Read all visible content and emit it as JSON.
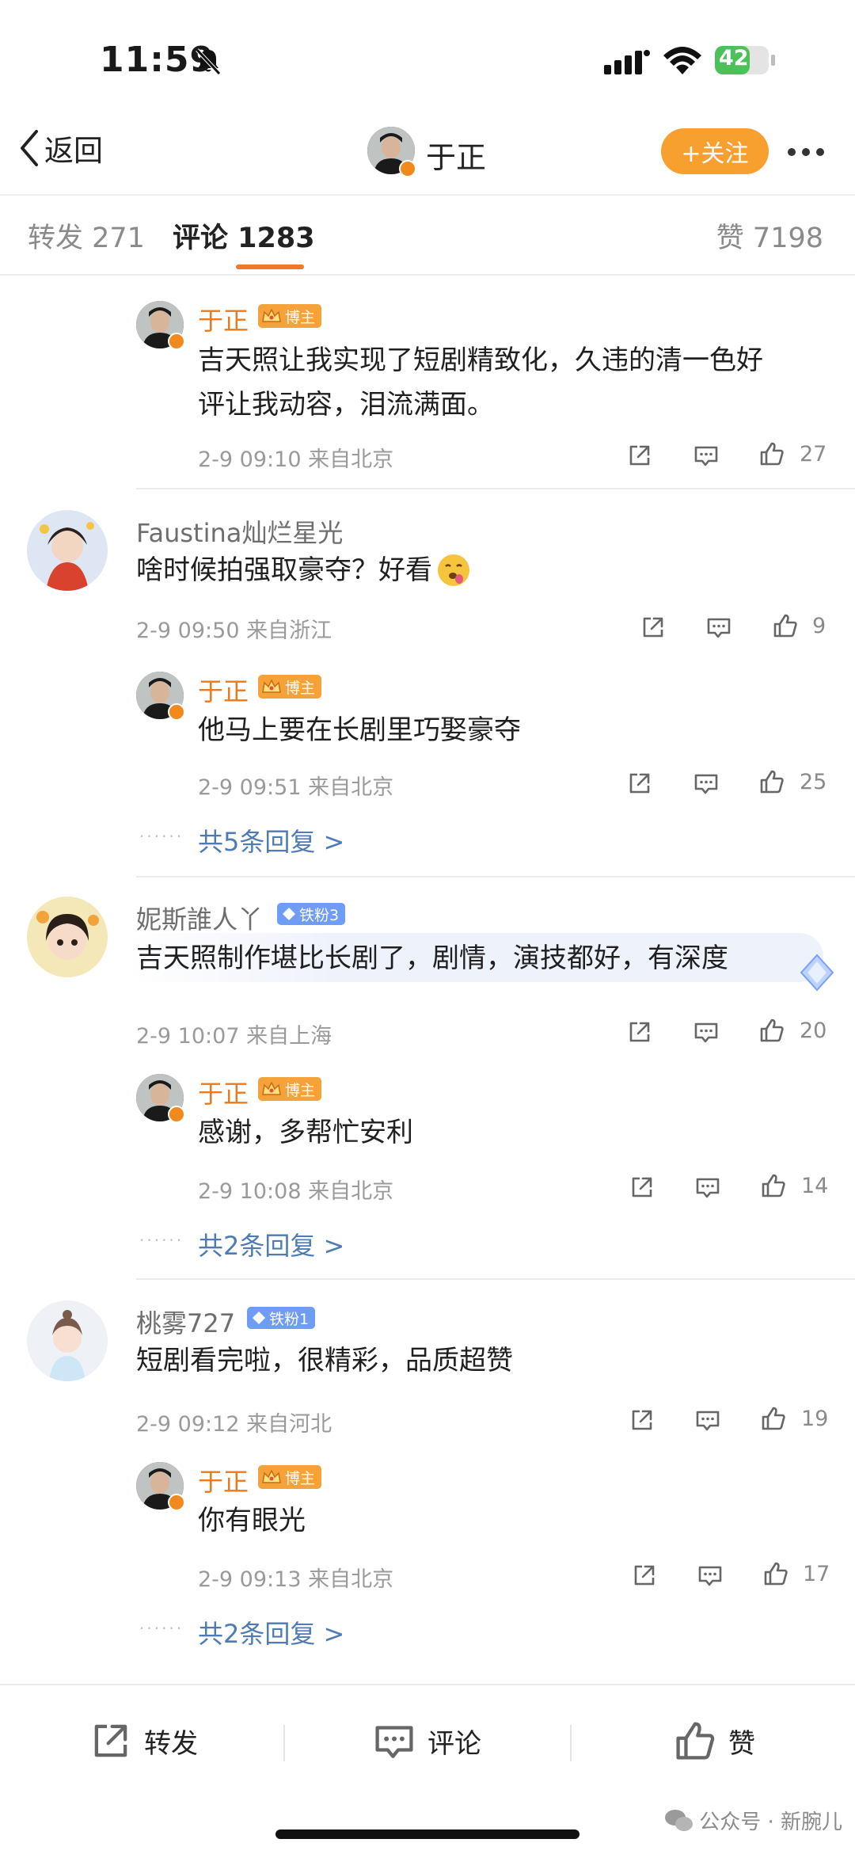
{
  "status_bar": {
    "time": "11:59",
    "battery": "42"
  },
  "header": {
    "back_label": "返回",
    "title": "于正",
    "follow_label": "+关注"
  },
  "tabs": {
    "repost": "转发 271",
    "comment": "评论 1283",
    "like": "赞 7198"
  },
  "comments": [
    {
      "reply": {
        "name": "于正",
        "badge": "博主",
        "text_line1": "吉天照让我实现了短剧精致化，久违的清一色好",
        "text_line2": "评让我动容，泪流满面。",
        "meta": "2-9 09:10  来自北京",
        "likes": "27"
      }
    },
    {
      "name": "Faustina灿烂星光",
      "text": "啥时候拍强取豪夺？好看",
      "meta": "2-9 09:50  来自浙江",
      "likes": "9",
      "reply": {
        "name": "于正",
        "badge": "博主",
        "text_line1": "他马上要在长剧里巧娶豪夺",
        "meta": "2-9 09:51  来自北京",
        "likes": "25"
      },
      "more_replies": "共5条回复 >"
    },
    {
      "name": "妮斯誰人丫",
      "fan_badge": "铁粉3",
      "text": "吉天照制作堪比长剧了，剧情，演技都好，有深度",
      "meta": "2-9 10:07  来自上海",
      "likes": "20",
      "reply": {
        "name": "于正",
        "badge": "博主",
        "text_line1": "感谢，多帮忙安利",
        "meta": "2-9 10:08  来自北京",
        "likes": "14"
      },
      "more_replies": "共2条回复 >"
    },
    {
      "name": "桃雾727",
      "fan_badge": "铁粉1",
      "text": "短剧看完啦，很精彩，品质超赞",
      "meta": "2-9 09:12  来自河北",
      "likes": "19",
      "reply": {
        "name": "于正",
        "badge": "博主",
        "text_line1": "你有眼光",
        "meta": "2-9 09:13  来自北京",
        "likes": "17"
      },
      "more_replies": "共2条回复 >"
    }
  ],
  "bottom_bar": {
    "repost": "转发",
    "comment": "评论",
    "like": "赞"
  },
  "watermark": "公众号 · 新腕儿",
  "colors": {
    "accent": "#f7a030",
    "blogger_name": "#ea7a20",
    "link": "#4f7bb5",
    "fan_badge": "#6f9cf4"
  }
}
